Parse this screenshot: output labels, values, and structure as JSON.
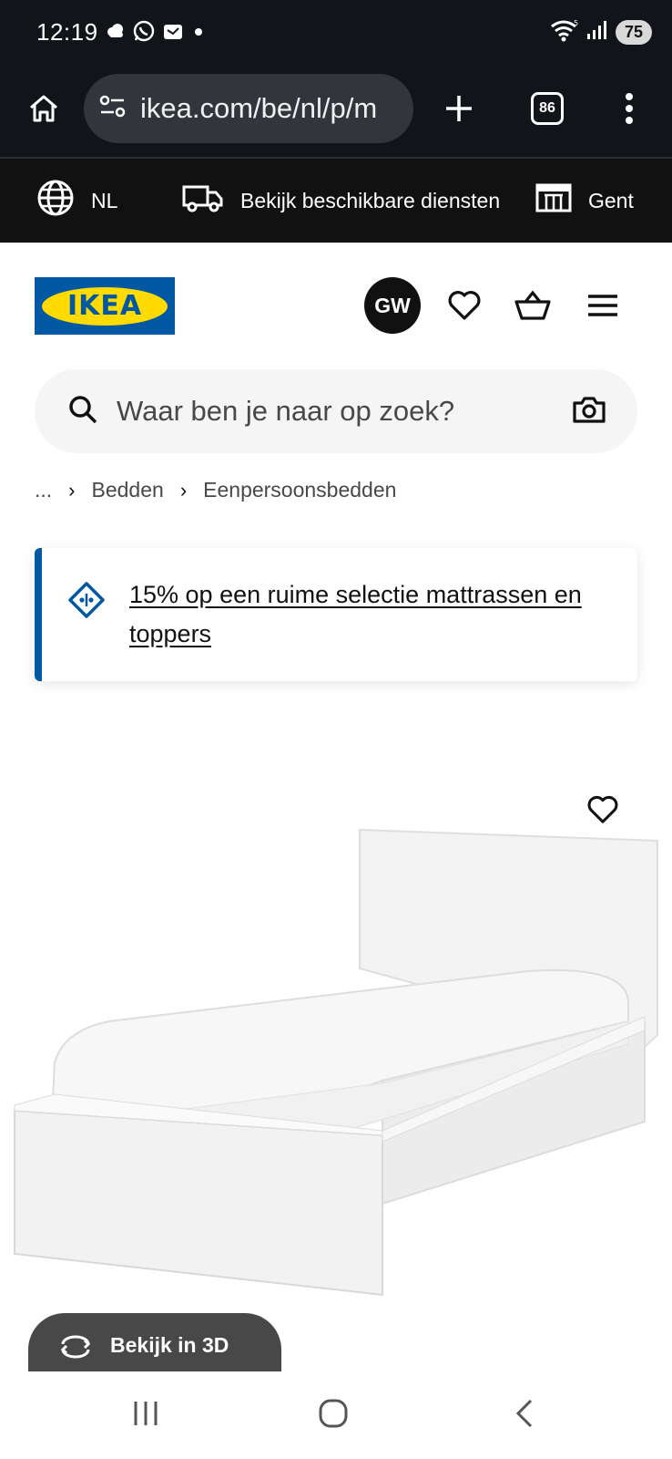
{
  "status_bar": {
    "time": "12:19",
    "battery": "75",
    "icons": [
      "cloud-icon",
      "whatsapp-icon",
      "app-notification-icon",
      "dot-icon",
      "wifi-icon",
      "signal-icon"
    ]
  },
  "browser": {
    "url": "ikea.com/be/nl/p/m",
    "tab_count": "86",
    "icons": [
      "home-icon",
      "site-settings-icon",
      "new-tab-icon",
      "more-icon"
    ]
  },
  "utility_bar": {
    "language": "NL",
    "services": "Bekijk beschikbare diensten",
    "store": "Gent"
  },
  "header": {
    "logo_text": "IKEA",
    "avatar_initials": "GW",
    "brand_colors": {
      "blue": "#0058a3",
      "yellow": "#ffdb00"
    }
  },
  "search": {
    "placeholder": "Waar ben je naar op zoek?"
  },
  "breadcrumb": {
    "ellipsis": "...",
    "items": [
      "Bedden",
      "Eenpersoonsbedden"
    ]
  },
  "promo": {
    "text": "15% op een ruime selectie mattrassen en toppers",
    "accent": "#0058a3"
  },
  "product": {
    "view_3d_label": "Bekijk in 3D"
  },
  "android_nav": {
    "icons": [
      "recents-icon",
      "home-circle-icon",
      "back-icon"
    ]
  }
}
